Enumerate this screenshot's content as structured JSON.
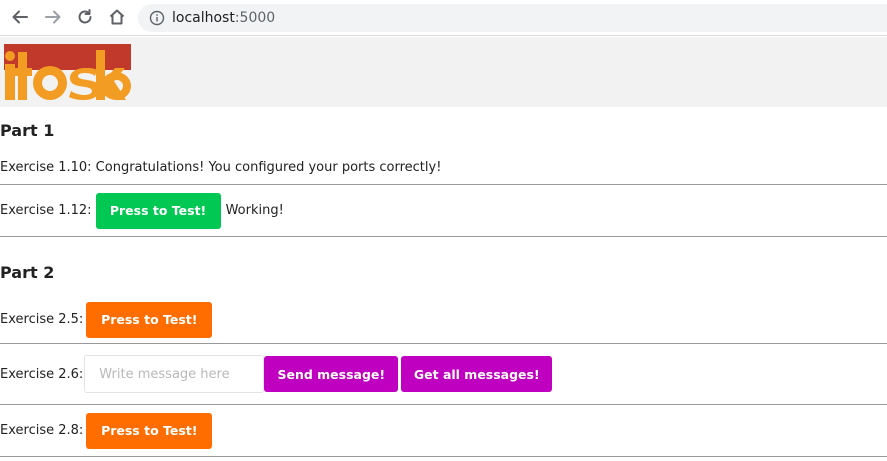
{
  "browser": {
    "url_host": "localhost",
    "url_port": ":5000",
    "icons": [
      "back-arrow-icon",
      "forward-arrow-icon",
      "reload-icon",
      "home-icon",
      "info-icon"
    ]
  },
  "header": {
    "logo_text": "toska",
    "colors": {
      "logo_orange": "#f39c23",
      "logo_red": "#c0392b"
    }
  },
  "part1": {
    "title": "Part 1",
    "ex110": {
      "text": "Exercise 1.10: Congratulations! You configured your ports correctly!"
    },
    "ex112": {
      "label": "Exercise 1.12:",
      "button": "Press to Test!",
      "status": "Working!"
    }
  },
  "part2": {
    "title": "Part 2",
    "ex25": {
      "label": "Exercise 2.5:",
      "button": "Press to Test!"
    },
    "ex26": {
      "label": "Exercise 2.6:",
      "input_placeholder": "Write message here",
      "input_value": "",
      "send_button": "Send message!",
      "get_button": "Get all messages!"
    },
    "ex28": {
      "label": "Exercise 2.8:",
      "button": "Press to Test!"
    }
  },
  "colors": {
    "green_button": "#00c853",
    "orange_button": "#ff6d00",
    "purple_button": "#c000c0"
  }
}
